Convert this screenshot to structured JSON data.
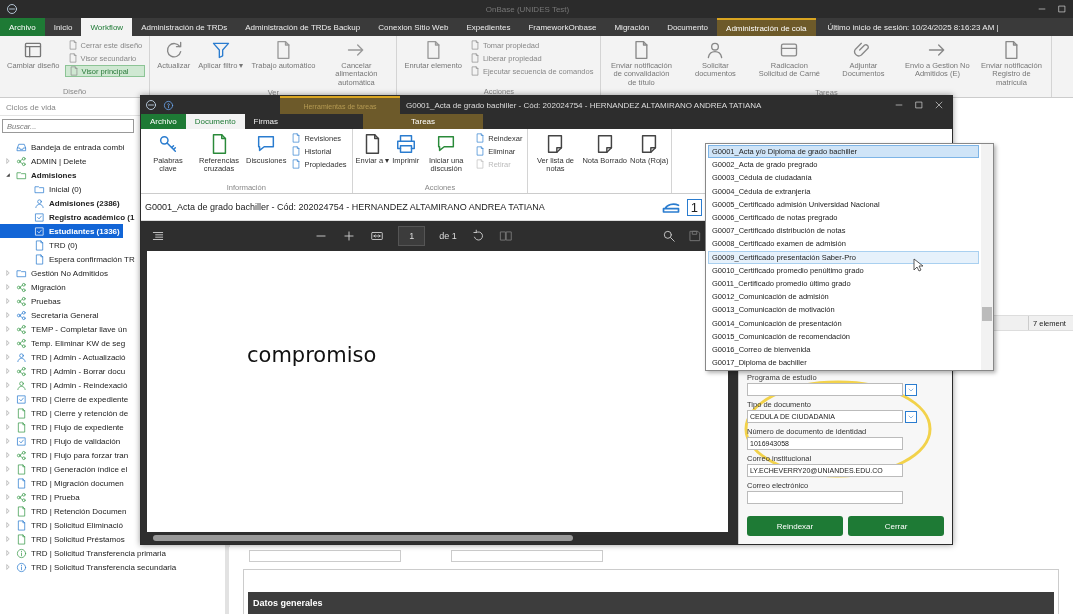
{
  "window": {
    "title": "OnBase (UNIDES Test)"
  },
  "menu_tabs": [
    {
      "label": "Archivo",
      "kind": "file",
      "selected": false
    },
    {
      "label": "Inicio",
      "kind": "tab",
      "selected": false
    },
    {
      "label": "Workflow",
      "kind": "tab",
      "selected": true
    },
    {
      "label": "Administración de TRDs",
      "kind": "tab",
      "selected": false
    },
    {
      "label": "Administración de TRDs Backup",
      "kind": "tab",
      "selected": false
    },
    {
      "label": "Conexion Sitio Web",
      "kind": "tab",
      "selected": false
    },
    {
      "label": "Expedientes",
      "kind": "tab",
      "selected": false
    },
    {
      "label": "FrameworkOnbase",
      "kind": "tab",
      "selected": false
    },
    {
      "label": "Migración",
      "kind": "tab",
      "selected": false
    },
    {
      "label": "Documento",
      "kind": "tab",
      "selected": false
    },
    {
      "label": "Administración de cola",
      "kind": "contextual",
      "selected": false
    }
  ],
  "session_info": "Último inicio de sesión: 10/24/2025 8:16:23 AM |",
  "ribbon": {
    "groups": [
      {
        "label": "Diseño",
        "items": [
          {
            "kind": "large",
            "label": "Cambiar diseño"
          },
          {
            "kind": "stack",
            "items": [
              {
                "label": "Cerrar este diseño",
                "selected": false
              },
              {
                "label": "Visor secundario",
                "selected": false
              },
              {
                "label": "Visor principal",
                "selected": true
              }
            ]
          }
        ]
      },
      {
        "label": "Ver",
        "items": [
          {
            "kind": "large",
            "label": "Actualizar"
          },
          {
            "kind": "large",
            "label": "Aplicar filtro ▾"
          },
          {
            "kind": "large",
            "label": "Trabajo automático"
          },
          {
            "kind": "large",
            "label": "Cancelar alimentación automática"
          }
        ]
      },
      {
        "label": "Acciones",
        "items": [
          {
            "kind": "large",
            "label": "Enrutar elemento"
          },
          {
            "kind": "stack",
            "items": [
              {
                "label": "Tomar propiedad"
              },
              {
                "label": "Liberar propiedad"
              },
              {
                "label": "Ejecutar secuencia de comandos"
              }
            ]
          }
        ]
      },
      {
        "label": "Tareas",
        "items": [
          {
            "kind": "large",
            "label": "Enviar notificación de convalidación de título"
          },
          {
            "kind": "large",
            "label": "Solicitar documentos"
          },
          {
            "kind": "large",
            "label": "Radicacion Solicitud de Carné"
          },
          {
            "kind": "large",
            "label": "Adjuntar Documentos"
          },
          {
            "kind": "large",
            "label": "Envio a Gestion No Admitidos (E)"
          },
          {
            "kind": "large",
            "label": "Enviar notificación Registro de matrícula"
          }
        ]
      }
    ]
  },
  "lifecycles": {
    "title": "Ciclos de vida",
    "search": {
      "placeholder": "Buscar..."
    },
    "items": [
      {
        "label": "Bandeja de entrada combi",
        "bold": false,
        "selected": false
      },
      {
        "label": "ADMIN | Delete",
        "bold": false,
        "selected": false,
        "expanded": false
      },
      {
        "label": "Admisiones",
        "bold": true,
        "selected": false,
        "expanded": true,
        "children": [
          {
            "label": "Inicial (0)",
            "bold": false,
            "selected": false
          },
          {
            "label": "Admisiones (2386)",
            "bold": true,
            "selected": false
          },
          {
            "label": "Registro académico (1",
            "bold": true,
            "selected": false
          },
          {
            "label": "Estudiantes (1336)",
            "bold": true,
            "selected": true
          },
          {
            "label": "TRD (0)",
            "bold": false,
            "selected": false
          },
          {
            "label": "Espera confirmación TR",
            "bold": false,
            "selected": false
          }
        ]
      },
      {
        "label": "Gestión No Admitidos",
        "bold": false,
        "selected": false,
        "expanded": false
      },
      {
        "label": "Migración",
        "bold": false,
        "selected": false,
        "expanded": false
      },
      {
        "label": "Pruebas",
        "bold": false,
        "selected": false,
        "expanded": false
      },
      {
        "label": "Secretaría General",
        "bold": false,
        "selected": false,
        "expanded": false
      },
      {
        "label": "TEMP - Completar llave ún",
        "bold": false,
        "selected": false,
        "expanded": false
      },
      {
        "label": "Temp. Eliminar KW de seg",
        "bold": false,
        "selected": false,
        "expanded": false
      },
      {
        "label": "TRD | Admin - Actualizació",
        "bold": false,
        "selected": false,
        "expanded": false
      },
      {
        "label": "TRD | Admin - Borrar docu",
        "bold": false,
        "selected": false,
        "expanded": false
      },
      {
        "label": "TRD | Admin - Reindexació",
        "bold": false,
        "selected": false,
        "expanded": false
      },
      {
        "label": "TRD | Cierre de expediente",
        "bold": false,
        "selected": false,
        "expanded": false
      },
      {
        "label": "TRD | Cierre y retención de",
        "bold": false,
        "selected": false,
        "expanded": false
      },
      {
        "label": "TRD | Flujo de expediente",
        "bold": false,
        "selected": false,
        "expanded": false
      },
      {
        "label": "TRD | Flujo de validación",
        "bold": false,
        "selected": false,
        "expanded": false
      },
      {
        "label": "TRD | Flujo para forzar tran",
        "bold": false,
        "selected": false,
        "expanded": false
      },
      {
        "label": "TRD | Generación índice el",
        "bold": false,
        "selected": false,
        "expanded": false
      },
      {
        "label": "TRD | Migración documen",
        "bold": false,
        "selected": false,
        "expanded": false
      },
      {
        "label": "TRD | Prueba",
        "bold": false,
        "selected": false,
        "expanded": false
      },
      {
        "label": "TRD | Retención Documen",
        "bold": false,
        "selected": false,
        "expanded": false
      },
      {
        "label": "TRD | Solicitud Eliminació",
        "bold": false,
        "selected": false,
        "expanded": false
      },
      {
        "label": "TRD | Solicitud Préstamos",
        "bold": false,
        "selected": false,
        "expanded": false
      },
      {
        "label": "TRD | Solicitud Transferencia primaria",
        "bold": false,
        "selected": false,
        "expanded": false
      },
      {
        "label": "TRD | Solicitud Transferencia secundaria",
        "bold": false,
        "selected": false,
        "expanded": false
      }
    ]
  },
  "results": {
    "count": "7 element",
    "section_title": "Datos generales"
  },
  "document_window": {
    "title": "G0001_Acta de grado bachiller - Cód: 202024754 - HERNANDEZ ALTAMIRANO ANDREA TATIANA",
    "contextual_header": "Herramientas de tareas",
    "tabs": [
      {
        "label": "Archivo",
        "kind": "file",
        "selected": false
      },
      {
        "label": "Documento",
        "kind": "tab",
        "selected": true
      },
      {
        "label": "Firmas",
        "kind": "tab",
        "selected": false
      },
      {
        "label": "Tareas",
        "kind": "contextual",
        "selected": false
      }
    ],
    "ribbon": {
      "groups": [
        {
          "label": "Información",
          "items": [
            {
              "kind": "large",
              "label": "Palabras clave"
            },
            {
              "kind": "large",
              "label": "Referencias cruzadas"
            },
            {
              "kind": "large",
              "label": "Discusiones"
            },
            {
              "kind": "stack",
              "items": [
                {
                  "label": "Revisiones"
                },
                {
                  "label": "Historial"
                },
                {
                  "label": "Propiedades"
                }
              ]
            }
          ]
        },
        {
          "label": "Acciones",
          "items": [
            {
              "kind": "large",
              "label": "Enviar a ▾"
            },
            {
              "kind": "large",
              "label": "Imprimir"
            },
            {
              "kind": "large",
              "label": "Iniciar una discusión"
            },
            {
              "kind": "stack",
              "items": [
                {
                  "label": "Reindexar",
                  "disabled": false
                },
                {
                  "label": "Eliminar",
                  "disabled": false
                },
                {
                  "label": "Retirar",
                  "disabled": true
                }
              ]
            }
          ]
        },
        {
          "items": [
            {
              "kind": "large",
              "label": "Ver lista de notas"
            },
            {
              "kind": "large",
              "label": "Nota Borrado"
            },
            {
              "kind": "large",
              "label": "Nota (Roja)"
            }
          ]
        }
      ]
    },
    "document_title": "G0001_Acta de grado bachiller - Cód: 202024754 - HERNANDEZ ALTAMIRANO ANDREA TATIANA",
    "count": "1",
    "viewer": {
      "page": "1",
      "page_total": "de 1",
      "content": "compromiso"
    },
    "form": {
      "fields": [
        {
          "label": "Programa de estudio",
          "kind": "select"
        },
        {
          "label": "Tipo de documento",
          "kind": "select",
          "value": "CEDULA DE CIUDADANIA"
        },
        {
          "label": "Número de documento de identidad",
          "kind": "text",
          "value": "1016943058"
        },
        {
          "label": "Correo institucional",
          "kind": "text",
          "value": "LY.ECHEVERRY20@UNIANDES.EDU.CO"
        },
        {
          "label": "Correo electrónico",
          "kind": "text"
        }
      ],
      "buttons": [
        {
          "label": "Reindexar"
        },
        {
          "label": "Cerrar"
        }
      ]
    }
  },
  "document_type_list": {
    "items": [
      {
        "label": "G0001_Acta y/o Diploma de grado bachiller",
        "selected": true,
        "hovered": false
      },
      {
        "label": "G0002_Acta de grado pregrado",
        "selected": false,
        "hovered": false
      },
      {
        "label": "G0003_Cédula de ciudadanía",
        "selected": false,
        "hovered": false
      },
      {
        "label": "G0004_Cédula de extranjería",
        "selected": false,
        "hovered": false
      },
      {
        "label": "G0005_Certificado admisión Universidad Nacional",
        "selected": false,
        "hovered": false
      },
      {
        "label": "G0006_Certificado de notas pregrado",
        "selected": false,
        "hovered": false
      },
      {
        "label": "G0007_Certificado distribución de notas",
        "selected": false,
        "hovered": false
      },
      {
        "label": "G0008_Certificado examen de admisión",
        "selected": false,
        "hovered": false
      },
      {
        "label": "G0009_Certificado presentación Saber-Pro",
        "selected": false,
        "hovered": true
      },
      {
        "label": "G0010_Certificado promedio penúltimo grado",
        "selected": false,
        "hovered": false
      },
      {
        "label": "G0011_Certificado promedio último grado",
        "selected": false,
        "hovered": false
      },
      {
        "label": "G0012_Comunicación de admisión",
        "selected": false,
        "hovered": false
      },
      {
        "label": "G0013_Comunicación de motivación",
        "selected": false,
        "hovered": false
      },
      {
        "label": "G0014_Comunicación de presentación",
        "selected": false,
        "hovered": false
      },
      {
        "label": "G0015_Comunicación de recomendación",
        "selected": false,
        "hovered": false
      },
      {
        "label": "G0016_Correo de bienvenida",
        "selected": false,
        "hovered": false
      },
      {
        "label": "G0017_Diploma de bachiller",
        "selected": false,
        "hovered": false
      }
    ]
  }
}
